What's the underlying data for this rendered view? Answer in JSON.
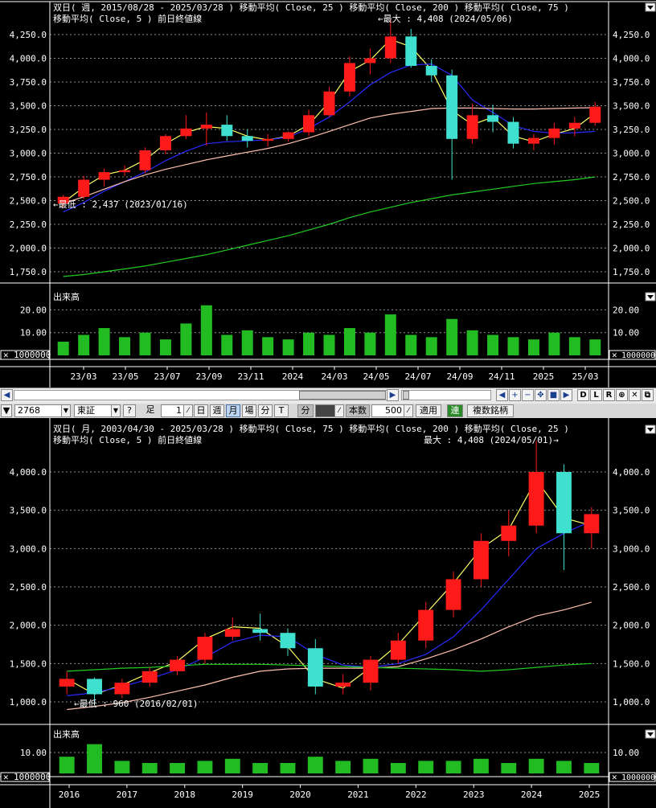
{
  "top_chart": {
    "legend_line1": "双日( 週, 2015/08/28 - 2025/03/28 )  移動平均( Close, 25 )  移動平均( Close, 200 )  移動平均( Close, 75 )",
    "legend_line2": "移動平均( Close, 5 )   前日終値線",
    "max_label": "←最大 : 4,408 (2024/05/06)",
    "min_label": "←最低 : 2,437 (2023/01/16)",
    "volume_title": "出来高",
    "volume_unit": "1000000",
    "volume_ticks": [
      "10.00",
      "20.00"
    ],
    "price_ticks": [
      "1,750.0",
      "2,000.0",
      "2,250.0",
      "2,500.0",
      "2,750.0",
      "3,000.0",
      "3,250.0",
      "3,500.0",
      "3,750.0",
      "4,000.0",
      "4,250.0"
    ],
    "date_ticks": [
      "23/03",
      "23/05",
      "23/07",
      "23/09",
      "23/11",
      "2024",
      "24/03",
      "24/05",
      "24/07",
      "24/09",
      "24/11",
      "2025",
      "25/03"
    ]
  },
  "bottom_chart": {
    "legend_line1": "双日( 月, 2003/04/30 - 2025/03/28 )  移動平均( Close, 75 )  移動平均( Close, 200 )  移動平均( Close, 25 )",
    "legend_line2": "移動平均( Close, 5 )   前日終値線",
    "max_label": "最大 : 4,408 (2024/05/01)→",
    "min_label": "←最低 : 960 (2016/02/01)",
    "volume_title": "出来高",
    "volume_unit": "1000000",
    "volume_ticks": [
      "10.00"
    ],
    "price_ticks": [
      "1,000.0",
      "1,500.0",
      "2,000.0",
      "2,500.0",
      "3,000.0",
      "3,500.0",
      "4,000.0"
    ],
    "date_ticks": [
      "2016",
      "2017",
      "2018",
      "2019",
      "2020",
      "2021",
      "2022",
      "2023",
      "2024",
      "2025"
    ]
  },
  "toolbar": {
    "code_value": "2768",
    "market_value": "東証",
    "help_label": "?",
    "ashi_label": "足",
    "ashi_value": "1",
    "day_label": "日",
    "week_label": "週",
    "month_label": "月",
    "session_label": "場",
    "minute_label": "分",
    "tick_label": "T",
    "bun_label": "分",
    "honsu_label": "本数",
    "honsu_value": "500",
    "apply_label": "適用",
    "ren_label": "連",
    "multi_label": "複数銘柄",
    "nav_labels": [
      "◀",
      "+",
      "−",
      "✥",
      "■",
      "▶",
      "D",
      "L",
      "R",
      "⊕",
      "✕",
      "⧉"
    ]
  },
  "colors": {
    "up": "#ff1a1a",
    "down": "#40e0d0",
    "ma5": "#ffff66",
    "ma25": "#2a2aff",
    "ma75": "#ffc0b0",
    "ma200": "#22cc22",
    "volume": "#22bb22"
  },
  "chart_data": [
    {
      "type": "candlestick",
      "title": "双日( 週, 2015/08/28 - 2025/03/28 )",
      "ylim": [
        1750,
        4408
      ],
      "x": [
        "2023/01",
        "2023/02",
        "2023/03",
        "2023/04",
        "2023/05",
        "2023/06",
        "2023/07",
        "2023/08",
        "2023/09",
        "2023/10",
        "2023/11",
        "2023/12",
        "2024/01",
        "2024/02",
        "2024/03",
        "2024/04",
        "2024/05",
        "2024/06",
        "2024/07",
        "2024/08",
        "2024/09",
        "2024/10",
        "2024/11",
        "2024/12",
        "2025/01",
        "2025/02",
        "2025/03"
      ],
      "ohlc": [
        [
          2470,
          2560,
          2437,
          2540
        ],
        [
          2540,
          2760,
          2520,
          2720
        ],
        [
          2720,
          2840,
          2650,
          2800
        ],
        [
          2800,
          2870,
          2760,
          2820
        ],
        [
          2820,
          3060,
          2790,
          3030
        ],
        [
          3030,
          3200,
          2990,
          3180
        ],
        [
          3180,
          3400,
          3150,
          3260
        ],
        [
          3260,
          3430,
          3080,
          3300
        ],
        [
          3300,
          3400,
          3130,
          3180
        ],
        [
          3180,
          3250,
          3060,
          3130
        ],
        [
          3130,
          3200,
          3070,
          3150
        ],
        [
          3150,
          3230,
          3120,
          3220
        ],
        [
          3220,
          3460,
          3180,
          3400
        ],
        [
          3400,
          3700,
          3380,
          3650
        ],
        [
          3650,
          4020,
          3600,
          3950
        ],
        [
          3950,
          4100,
          3830,
          4000
        ],
        [
          4000,
          4408,
          3950,
          4230
        ],
        [
          4230,
          4310,
          3900,
          3920
        ],
        [
          3920,
          3990,
          3750,
          3820
        ],
        [
          3820,
          3880,
          2720,
          3150
        ],
        [
          3150,
          3520,
          3100,
          3400
        ],
        [
          3400,
          3510,
          3220,
          3330
        ],
        [
          3330,
          3380,
          3050,
          3100
        ],
        [
          3100,
          3200,
          3030,
          3160
        ],
        [
          3160,
          3320,
          3090,
          3260
        ],
        [
          3260,
          3380,
          3180,
          3320
        ],
        [
          3320,
          3540,
          3290,
          3490
        ]
      ],
      "series": [
        {
          "name": "移動平均( Close, 5 )",
          "values": [
            2480,
            2640,
            2770,
            2820,
            2930,
            3100,
            3220,
            3280,
            3260,
            3180,
            3140,
            3180,
            3300,
            3540,
            3860,
            3980,
            4200,
            4120,
            3880,
            3450,
            3300,
            3380,
            3180,
            3120,
            3200,
            3260,
            3420
          ]
        },
        {
          "name": "移動平均( Close, 25 )",
          "values": [
            2380,
            2480,
            2600,
            2700,
            2800,
            2920,
            3020,
            3100,
            3120,
            3130,
            3140,
            3170,
            3260,
            3380,
            3540,
            3720,
            3850,
            3930,
            3940,
            3820,
            3560,
            3430,
            3290,
            3230,
            3210,
            3215,
            3230
          ]
        },
        {
          "name": "移動平均( Close, 75 )",
          "values": [
            2470,
            2540,
            2620,
            2700,
            2770,
            2830,
            2880,
            2930,
            2970,
            3010,
            3050,
            3100,
            3160,
            3230,
            3300,
            3370,
            3410,
            3440,
            3470,
            3475,
            3475,
            3470,
            3465,
            3465,
            3470,
            3475,
            3480
          ]
        },
        {
          "name": "移動平均( Close, 200 )",
          "values": [
            1700,
            1720,
            1750,
            1780,
            1810,
            1850,
            1890,
            1930,
            1980,
            2030,
            2080,
            2130,
            2190,
            2250,
            2320,
            2380,
            2430,
            2480,
            2520,
            2560,
            2590,
            2620,
            2650,
            2680,
            2700,
            2720,
            2750
          ]
        }
      ],
      "volume": [
        6,
        9,
        12,
        8,
        10,
        7,
        14,
        22,
        9,
        11,
        8,
        7,
        10,
        9,
        12,
        10,
        18,
        9,
        8,
        16,
        11,
        9,
        8,
        7,
        10,
        8,
        7
      ]
    },
    {
      "type": "candlestick",
      "title": "双日( 月, 2003/04/30 - 2025/03/28 )",
      "ylim": [
        960,
        4408
      ],
      "x": [
        "2015/08",
        "2016/02",
        "2016/08",
        "2017/02",
        "2017/08",
        "2018/02",
        "2018/08",
        "2019/02",
        "2019/08",
        "2020/02",
        "2020/08",
        "2021/02",
        "2021/08",
        "2022/02",
        "2022/08",
        "2023/02",
        "2023/08",
        "2024/02",
        "2024/08",
        "2025/02"
      ],
      "ohlc": [
        [
          1200,
          1400,
          1100,
          1300
        ],
        [
          1300,
          1320,
          960,
          1100
        ],
        [
          1100,
          1300,
          1050,
          1250
        ],
        [
          1250,
          1450,
          1200,
          1400
        ],
        [
          1400,
          1600,
          1350,
          1550
        ],
        [
          1550,
          1900,
          1500,
          1850
        ],
        [
          1850,
          2100,
          1800,
          1950
        ],
        [
          1950,
          2150,
          1800,
          1900
        ],
        [
          1900,
          1960,
          1600,
          1700
        ],
        [
          1700,
          1820,
          1100,
          1200
        ],
        [
          1200,
          1360,
          1100,
          1250
        ],
        [
          1250,
          1600,
          1150,
          1550
        ],
        [
          1550,
          1900,
          1500,
          1800
        ],
        [
          1800,
          2300,
          1700,
          2200
        ],
        [
          2200,
          2700,
          2100,
          2600
        ],
        [
          2600,
          3200,
          2500,
          3100
        ],
        [
          3100,
          3500,
          2900,
          3300
        ],
        [
          3300,
          4408,
          3200,
          4000
        ],
        [
          4000,
          4100,
          2720,
          3200
        ],
        [
          3200,
          3540,
          3000,
          3450
        ]
      ],
      "series": [
        {
          "name": "移動平均( Close, 5 )",
          "values": [
            1300,
            1100,
            1220,
            1380,
            1530,
            1820,
            1980,
            1960,
            1720,
            1300,
            1180,
            1450,
            1750,
            2150,
            2550,
            3000,
            3250,
            3900,
            3400,
            3300
          ]
        },
        {
          "name": "移動平均( Close, 25 )",
          "values": [
            1080,
            1120,
            1200,
            1300,
            1420,
            1580,
            1780,
            1870,
            1850,
            1620,
            1480,
            1450,
            1500,
            1620,
            1850,
            2200,
            2600,
            3000,
            3200,
            3360
          ]
        },
        {
          "name": "移動平均( Close, 75 )",
          "values": [
            900,
            940,
            990,
            1060,
            1140,
            1220,
            1320,
            1400,
            1430,
            1440,
            1440,
            1440,
            1460,
            1560,
            1680,
            1820,
            1980,
            2120,
            2200,
            2300
          ]
        },
        {
          "name": "移動平均( Close, 200 )",
          "values": [
            1400,
            1420,
            1440,
            1450,
            1470,
            1490,
            1490,
            1490,
            1480,
            1470,
            1460,
            1450,
            1440,
            1430,
            1420,
            1400,
            1420,
            1450,
            1480,
            1500
          ]
        }
      ],
      "volume": [
        8,
        14,
        6,
        5,
        5,
        6,
        7,
        5,
        5,
        8,
        6,
        7,
        5,
        6,
        6,
        7,
        5,
        7,
        6,
        5
      ]
    }
  ]
}
